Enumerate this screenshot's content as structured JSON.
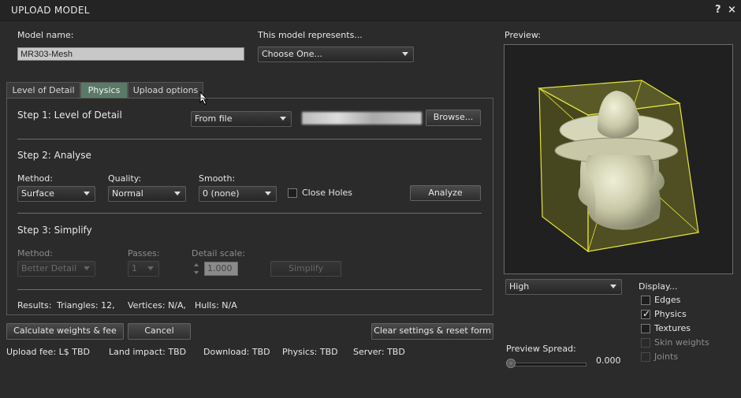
{
  "window": {
    "title": "UPLOAD MODEL",
    "help_icon": "?",
    "close_icon": "×"
  },
  "model": {
    "name_label": "Model name:",
    "name_value": "MR303-Mesh",
    "represents_label": "This model represents...",
    "represents_value": "Choose One..."
  },
  "tabs": [
    {
      "label": "Level of Detail",
      "active": false
    },
    {
      "label": "Physics",
      "active": true
    },
    {
      "label": "Upload options",
      "active": false
    }
  ],
  "step1": {
    "title": "Step 1: Level of Detail",
    "source": "From file",
    "browse": "Browse..."
  },
  "step2": {
    "title": "Step 2: Analyse",
    "method_label": "Method:",
    "method_value": "Surface",
    "quality_label": "Quality:",
    "quality_value": "Normal",
    "smooth_label": "Smooth:",
    "smooth_value": "0 (none)",
    "close_holes": "Close Holes",
    "close_holes_checked": false,
    "analyze": "Analyze"
  },
  "step3": {
    "title": "Step 3: Simplify",
    "method_label": "Method:",
    "method_value": "Better Detail",
    "passes_label": "Passes:",
    "passes_value": "1",
    "detail_scale_label": "Detail scale:",
    "detail_scale_value": "1.000",
    "simplify": "Simplify"
  },
  "results": {
    "label": "Results:",
    "triangles": "Triangles: 12,",
    "vertices": "Vertices: N/A,",
    "hulls": "Hulls: N/A"
  },
  "buttons": {
    "calculate": "Calculate weights & fee",
    "cancel": "Cancel",
    "clear": "Clear settings & reset form"
  },
  "fees": {
    "upload": "Upload fee: L$ TBD",
    "land_impact": "Land impact: TBD",
    "download": "Download: TBD",
    "physics": "Physics: TBD",
    "server": "Server: TBD"
  },
  "preview": {
    "label": "Preview:",
    "lod_value": "High",
    "display_label": "Display...",
    "options": [
      {
        "label": "Edges",
        "checked": false,
        "enabled": true
      },
      {
        "label": "Physics",
        "checked": true,
        "enabled": true
      },
      {
        "label": "Textures",
        "checked": false,
        "enabled": true
      },
      {
        "label": "Skin weights",
        "checked": false,
        "enabled": false
      },
      {
        "label": "Joints",
        "checked": false,
        "enabled": false
      }
    ],
    "spread_label": "Preview Spread:",
    "spread_value": "0.000",
    "spread_fraction": 0.0
  },
  "colors": {
    "accent_tab": "#5a7a68",
    "hull": "#e6e63a",
    "mesh": "#d8d8b8"
  }
}
